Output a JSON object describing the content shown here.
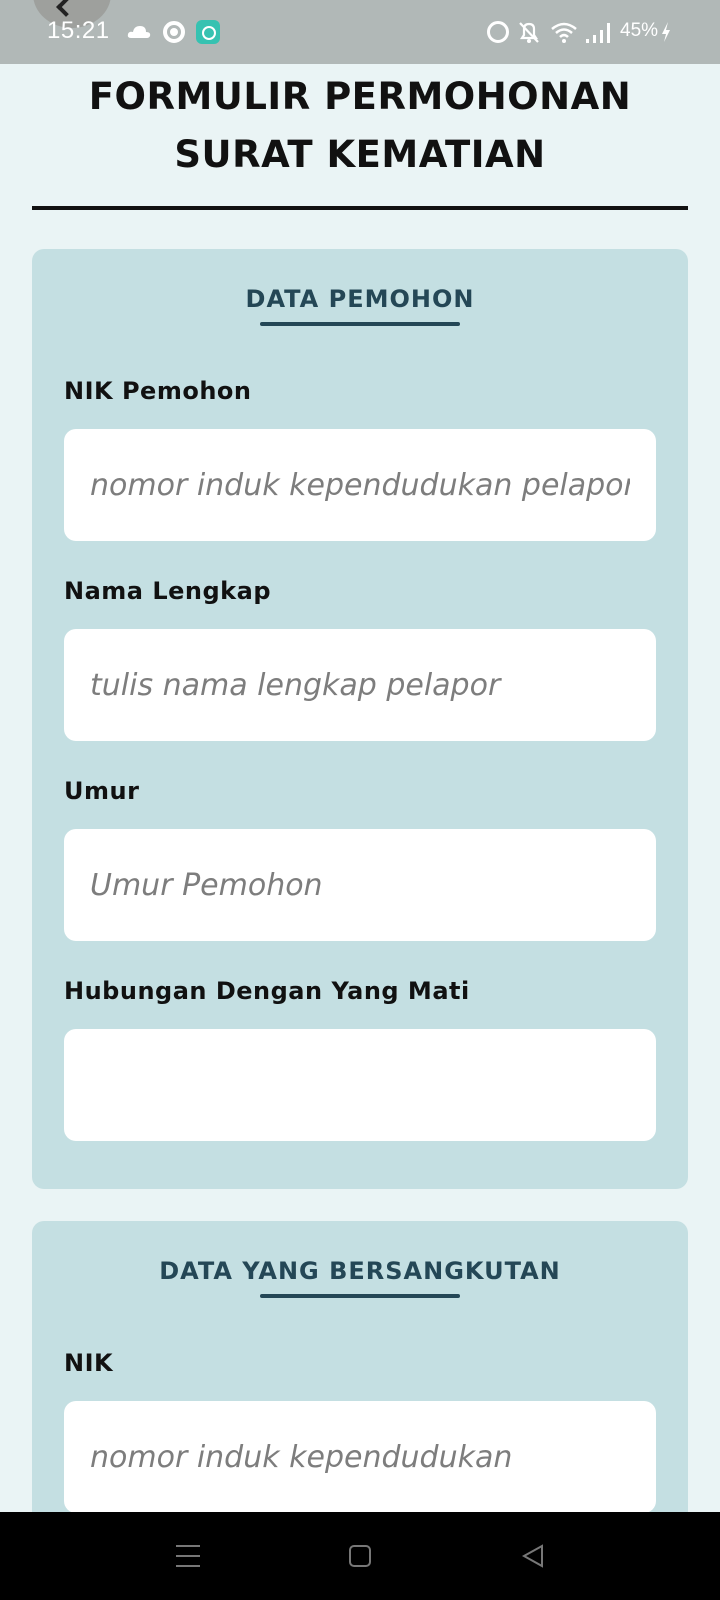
{
  "status_bar": {
    "time": "15:21",
    "battery": "45%",
    "icons": [
      "cloud-icon",
      "target-icon",
      "app-icon",
      "alarm-icon",
      "bell-off-icon",
      "wifi-icon",
      "signal-icon",
      "charging-bolt-icon"
    ]
  },
  "header": {
    "title_line1": "FORMULIR PERMOHONAN",
    "title_line2": "SURAT KEMATIAN"
  },
  "section_pemohon": {
    "title": "DATA PEMOHON",
    "fields": [
      {
        "label": "NIK Pemohon",
        "placeholder": "nomor induk kependudukan pelapor",
        "value": ""
      },
      {
        "label": "Nama Lengkap",
        "placeholder": "tulis nama lengkap pelapor",
        "value": ""
      },
      {
        "label": "Umur",
        "placeholder": "Umur Pemohon",
        "value": ""
      },
      {
        "label": "Hubungan Dengan Yang Mati",
        "placeholder": "",
        "value": ""
      }
    ]
  },
  "section_bersangkutan": {
    "title": "DATA YANG BERSANGKUTAN",
    "fields": [
      {
        "label": "NIK",
        "placeholder": "nomor induk kependudukan",
        "value": ""
      }
    ]
  },
  "colors": {
    "background": "#eaf4f5",
    "card": "#c4dfe2",
    "section_title": "#244756",
    "status_bar": "#b1b8b7"
  }
}
